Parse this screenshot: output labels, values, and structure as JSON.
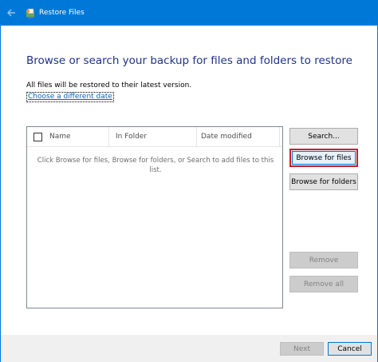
{
  "window": {
    "title": "Restore Files",
    "accent_color": "#0078d7",
    "heading_color": "#1e3287"
  },
  "main": {
    "heading": "Browse or search your backup for files and folders to restore",
    "info": "All files will be restored to their latest version.",
    "date_link": "Choose a different date"
  },
  "filelist": {
    "columns": [
      "Name",
      "In Folder",
      "Date modified"
    ],
    "empty_message": "Click Browse for files, Browse for folders, or Search to add files to this list."
  },
  "buttons": {
    "search": "Search...",
    "browse_files": "Browse for files",
    "browse_folders": "Browse for folders",
    "remove": "Remove",
    "remove_all": "Remove all",
    "highlight_color": "#cc1c2b"
  },
  "footer": {
    "next": "Next",
    "cancel": "Cancel"
  },
  "icons": {
    "back": "back-arrow-icon",
    "app": "restore-files-icon",
    "checkbox": "checkbox-icon"
  }
}
